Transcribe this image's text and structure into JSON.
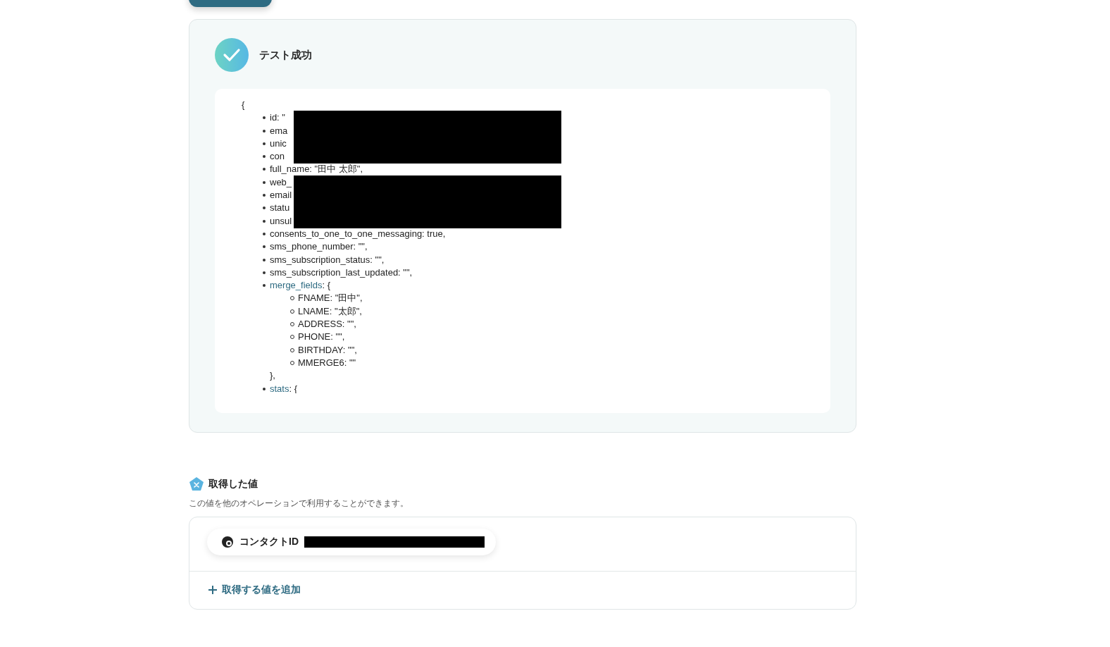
{
  "test_result": {
    "title": "テスト成功",
    "open_brace": "{",
    "lines": [
      {
        "text": "id: \"",
        "kind": "field",
        "redacted": true
      },
      {
        "text": "ema",
        "kind": "field",
        "redacted": true
      },
      {
        "text": "unic",
        "kind": "field",
        "redacted": true
      },
      {
        "text": "con",
        "kind": "field",
        "redacted": true
      },
      {
        "text": "full_name: \"田中 太郎\",",
        "kind": "field",
        "redacted": false
      },
      {
        "text": "web_",
        "kind": "field",
        "redacted": true
      },
      {
        "text": "email",
        "kind": "field",
        "redacted": true
      },
      {
        "text": "statu",
        "kind": "field",
        "redacted": true
      },
      {
        "text": "unsul",
        "kind": "field",
        "redacted": true
      },
      {
        "text": "consents_to_one_to_one_messaging: true,",
        "kind": "field",
        "redacted": false
      },
      {
        "text": "sms_phone_number: \"\",",
        "kind": "field",
        "redacted": false
      },
      {
        "text": "sms_subscription_status: \"\",",
        "kind": "field",
        "redacted": false
      },
      {
        "text": "sms_subscription_last_updated: \"\",",
        "kind": "field",
        "redacted": false
      },
      {
        "key": "merge_fields",
        "text": ": {",
        "kind": "object",
        "redacted": false,
        "close": "},",
        "children": [
          {
            "text": "FNAME: \"田中\","
          },
          {
            "text": "LNAME: \"太郎\","
          },
          {
            "text": "ADDRESS: \"\","
          },
          {
            "text": "PHONE: \"\","
          },
          {
            "text": "BIRTHDAY: \"\","
          },
          {
            "text": "MMERGE6: \"\""
          }
        ]
      },
      {
        "key": "stats",
        "text": ": {",
        "kind": "object",
        "redacted": false
      }
    ]
  },
  "obtained_values": {
    "title": "取得した値",
    "description": "この値を他のオペレーションで利用することができます。",
    "items": [
      {
        "label": "コンタクトID",
        "redacted": true
      }
    ],
    "add_button": "取得する値を追加"
  }
}
